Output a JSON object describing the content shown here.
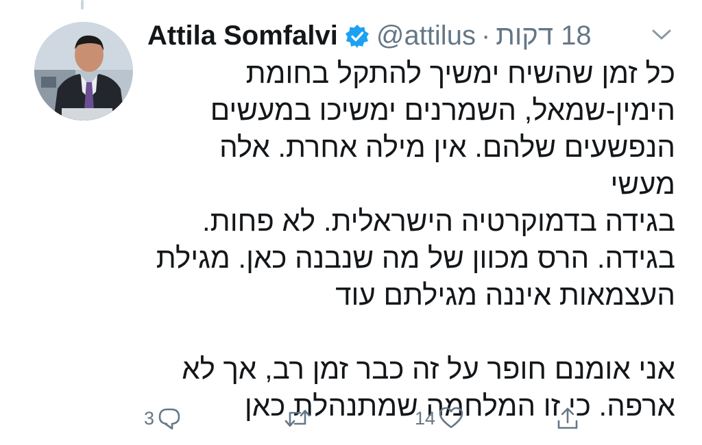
{
  "tweet": {
    "author_name": "Attila Somfalvi",
    "verified": true,
    "handle": "@attilus",
    "separator": "·",
    "timestamp": "18 דקות",
    "text_lines": [
      "כל זמן שהשיח ימשיך להתקל בחומת",
      "הימין-שמאל, השמרנים ימשיכו במעשים",
      "הנפשעים שלהם. אין מילה אחרת. אלה מעשי",
      "בגידה בדמוקרטיה הישראלית. לא פחות.",
      "בגידה. הרס מכוון של מה שנבנה כאן. מגילת",
      "העצמאות איננה מגילתם עוד",
      "",
      "אני אומנם חופר על זה כבר זמן רב, אך לא",
      "ארפה. כי זו המלחמה שמתנהלת כאן"
    ],
    "actions": {
      "reply_count": "3",
      "retweet_count": "",
      "like_count": "14"
    }
  },
  "icons": {
    "verified": "verified-badge-icon",
    "caret": "chevron-down-icon",
    "reply": "reply-icon",
    "retweet": "retweet-icon",
    "like": "heart-icon",
    "share": "share-icon"
  },
  "colors": {
    "verified_blue": "#1da1f2",
    "secondary_text": "#657786",
    "primary_text": "#14171a"
  }
}
